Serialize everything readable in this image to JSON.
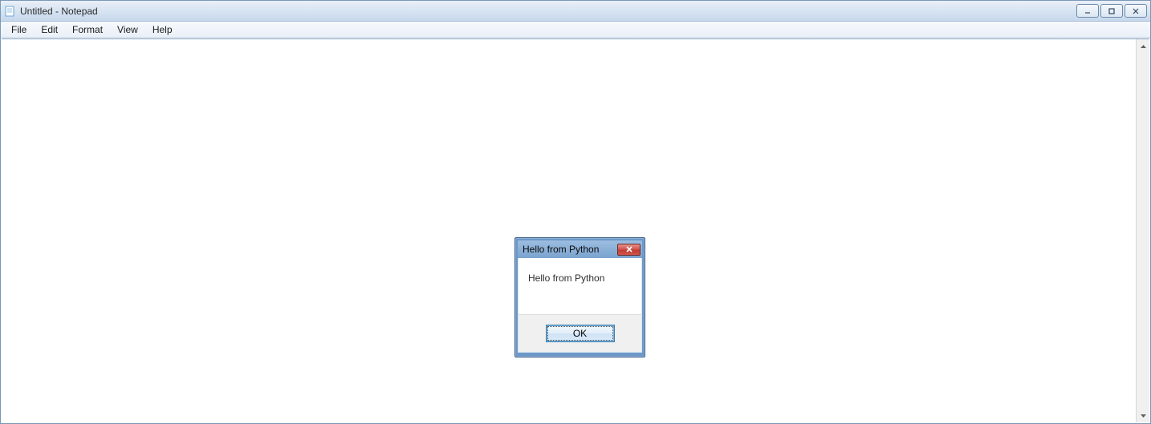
{
  "window": {
    "title": "Untitled - Notepad"
  },
  "menu": {
    "items": [
      "File",
      "Edit",
      "Format",
      "View",
      "Help"
    ]
  },
  "editor": {
    "content": ""
  },
  "dialog": {
    "title": "Hello from Python",
    "message": "Hello from Python",
    "ok_label": "OK"
  }
}
